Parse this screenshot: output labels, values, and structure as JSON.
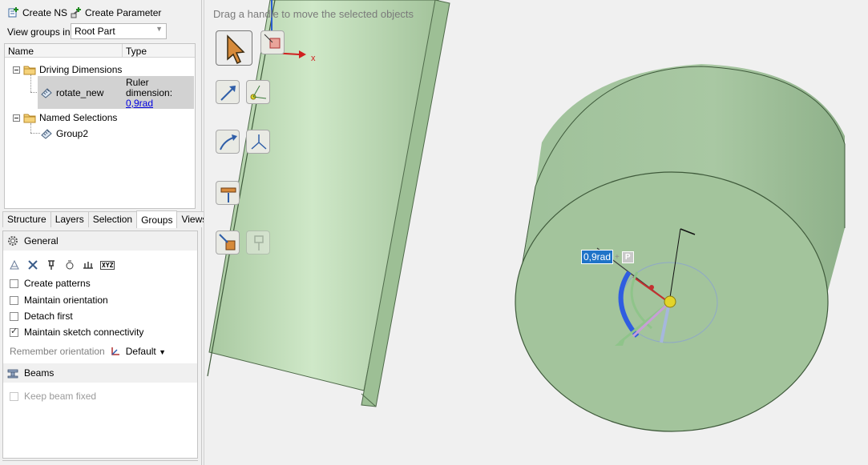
{
  "toolbar": {
    "create_ns": "Create NS",
    "create_parameter": "Create Parameter"
  },
  "view_groups": {
    "label": "View groups in:",
    "value": "Root Part"
  },
  "tree": {
    "columns": [
      "Name",
      "Type"
    ],
    "driving_dimensions": "Driving Dimensions",
    "rotate_new": {
      "name": "rotate_new",
      "type_line1": "Ruler",
      "type_line2": "dimension:",
      "type_value": "0,9rad"
    },
    "named_selections": "Named Selections",
    "group2": "Group2"
  },
  "tabs": [
    "Structure",
    "Layers",
    "Selection",
    "Groups",
    "Views"
  ],
  "active_tab": "Groups",
  "props": {
    "general": "General",
    "create_patterns": "Create patterns",
    "maintain_orientation": "Maintain orientation",
    "detach_first": "Detach first",
    "maintain_sketch": "Maintain sketch connectivity",
    "remember_orientation": "Remember orientation",
    "orientation_value": "Default",
    "beams": "Beams",
    "keep_beam_fixed": "Keep beam fixed",
    "checked": {
      "create_patterns": false,
      "maintain_orientation": false,
      "detach_first": false,
      "maintain_sketch": true,
      "keep_beam_fixed": false
    },
    "icon_xyz": "XYZ"
  },
  "viewport": {
    "hint": "Drag a handle to move the selected objects",
    "dimension_value": "0,9rad",
    "dimension_tag": "P",
    "axis_x": "x"
  },
  "colors": {
    "selection_blue": "#1f73c8",
    "part_green": "#9fc49a",
    "tree_highlight": "#d2d2d2"
  }
}
